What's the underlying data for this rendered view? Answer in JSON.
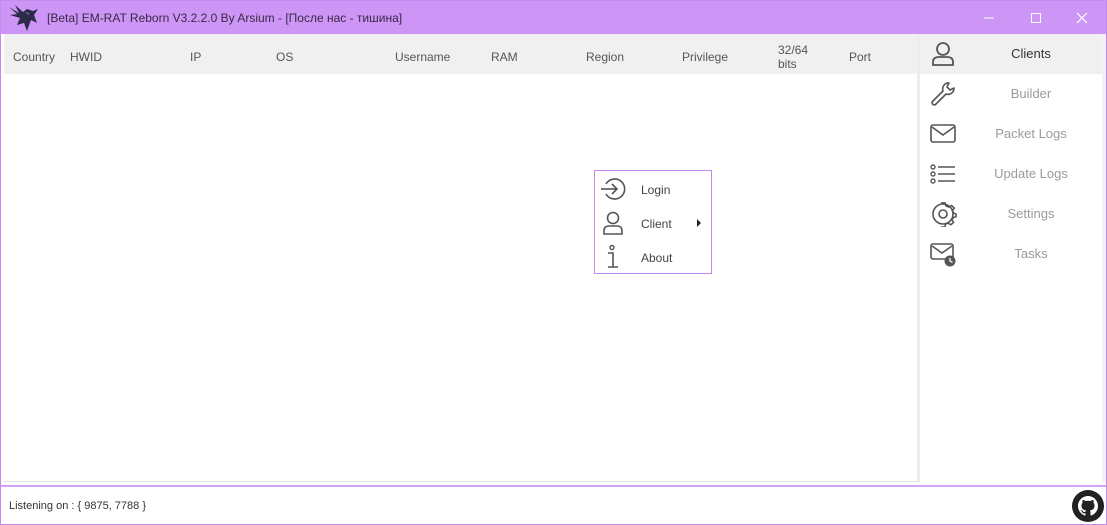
{
  "window": {
    "title": "[Beta] EM-RAT Reborn V3.2.2.0 By Arsium - [После нас - тишина]",
    "accent_color": "#cd95f5",
    "icons": [
      "raven-logo-icon",
      "minimize-icon",
      "maximize-icon",
      "close-icon"
    ]
  },
  "columns": [
    {
      "label": "Country"
    },
    {
      "label": "HWID"
    },
    {
      "label": "IP"
    },
    {
      "label": "OS"
    },
    {
      "label": "Username"
    },
    {
      "label": "RAM"
    },
    {
      "label": "Region"
    },
    {
      "label": "Privilege"
    },
    {
      "label_line1": "32/64",
      "label_line2": "bits"
    },
    {
      "label": "Port"
    }
  ],
  "sidebar": {
    "items": [
      {
        "label": "Clients",
        "icon": "user-icon",
        "active": true
      },
      {
        "label": "Builder",
        "icon": "wrench-icon"
      },
      {
        "label": "Packet Logs",
        "icon": "envelope-icon"
      },
      {
        "label": "Update Logs",
        "icon": "list-icon"
      },
      {
        "label": "Settings",
        "icon": "gear-icon"
      },
      {
        "label": "Tasks",
        "icon": "envelope-clock-icon"
      }
    ]
  },
  "context_menu": {
    "items": [
      {
        "label": "Login",
        "icon": "login-arrow-icon"
      },
      {
        "label": "Client",
        "icon": "user-icon",
        "has_submenu": true
      },
      {
        "label": "About",
        "icon": "info-icon"
      }
    ]
  },
  "status": {
    "text": "Listening on : { 9875, 7788 }",
    "github_icon": "github-icon"
  }
}
